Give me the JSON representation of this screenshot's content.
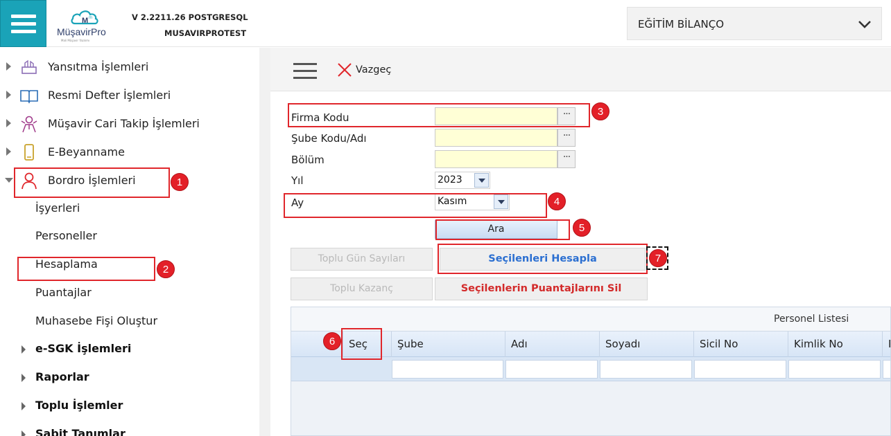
{
  "header": {
    "logo_text": "MüşavirPro",
    "logo_tagline": "Mali Müşavir Yazılımı",
    "version": "V 2.2211.26 POSTGRESQL",
    "database": "MUSAVIRPROTEST",
    "company_selector": "EĞİTİM BİLANÇO",
    "accent_color": "#1aa3b8"
  },
  "sidebar": {
    "items": [
      {
        "label": "Yansıtma İşlemleri",
        "icon": "reflect-icon"
      },
      {
        "label": "Resmi Defter İşlemleri",
        "icon": "book-icon"
      },
      {
        "label": "Müşavir Cari Takip İşlemleri",
        "icon": "advisor-icon"
      },
      {
        "label": "E-Beyanname",
        "icon": "phone-icon"
      },
      {
        "label": "Bordro İşlemleri",
        "icon": "person-icon",
        "expanded": true
      }
    ],
    "subitems": [
      "İşyerleri",
      "Personeller",
      "Hesaplama",
      "Puantajlar",
      "Muhasebe Fişi Oluştur"
    ],
    "groups": [
      "e-SGK İşlemleri",
      "Raporlar",
      "Toplu İşlemler",
      "Sabit Tanımlar"
    ]
  },
  "toolbar": {
    "cancel_label": "Vazgeç"
  },
  "form": {
    "firma_kodu_label": "Firma Kodu",
    "sube_label": "Şube Kodu/Adı",
    "bolum_label": "Bölüm",
    "yil_label": "Yıl",
    "yil_value": "2023",
    "ay_label": "Ay",
    "ay_value": "Kasım",
    "lookup_button": "···",
    "search_button": "Ara"
  },
  "actions": {
    "toplu_gun": "Toplu Gün Sayıları",
    "secilenleri_hesapla": "Seçilenleri Hesapla",
    "toplu_kazanc": "Toplu Kazanç",
    "puantaj_sil": "Seçilenlerin Puantajlarını Sil"
  },
  "grid": {
    "title": "Personel Listesi",
    "columns": [
      "Seç",
      "Şube",
      "Adı",
      "Soyadı",
      "Sicil No",
      "Kimlik No",
      "P"
    ]
  },
  "annotations": [
    "1",
    "2",
    "3",
    "4",
    "5",
    "6",
    "7"
  ],
  "colors": {
    "annotation": "#e32028",
    "highlight_blue": "#2b6fd1",
    "highlight_red": "#d32b2b",
    "input_yellow": "#ffffd6"
  }
}
